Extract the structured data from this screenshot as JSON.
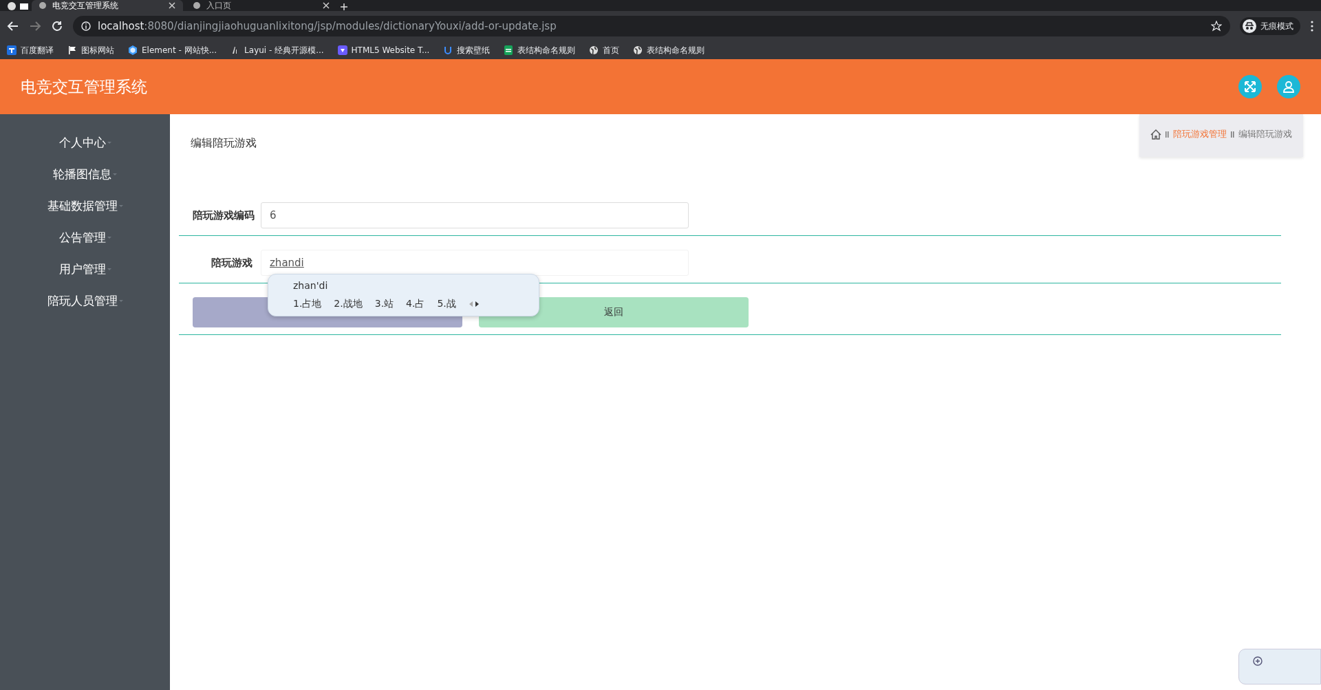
{
  "browser": {
    "tabs": [
      {
        "title": "电竞交互管理系统",
        "selected": true
      },
      {
        "title": "入口页",
        "selected": false
      }
    ],
    "address": {
      "host": "localhost",
      "path": ":8080/dianjingjiaohuguanlixitong/jsp/modules/dictionaryYouxi/add-or-update.jsp"
    },
    "profile": "无痕模式",
    "bookmarks": [
      {
        "label": "百度翻译",
        "kind": "translate"
      },
      {
        "label": "图标网站",
        "kind": "flag"
      },
      {
        "label": "Element - 网站快...",
        "kind": "element"
      },
      {
        "label": "Layui - 经典开源模...",
        "kind": "layui"
      },
      {
        "label": "HTML5 Website T...",
        "kind": "html5"
      },
      {
        "label": "搜索壁纸",
        "kind": "wallpaper"
      },
      {
        "label": "表结构命名规则",
        "kind": "sheet"
      },
      {
        "label": "首页",
        "kind": "globe"
      },
      {
        "label": "表结构命名规则",
        "kind": "globe"
      }
    ]
  },
  "header": {
    "title": "电竞交互管理系统"
  },
  "sidebar": {
    "items": [
      "个人中心",
      "轮播图信息",
      "基础数据管理",
      "公告管理",
      "用户管理",
      "陪玩人员管理"
    ]
  },
  "page": {
    "title": "编辑陪玩游戏",
    "breadcrumb": [
      "陪玩游戏管理",
      "编辑陪玩游戏"
    ]
  },
  "form": {
    "fields": [
      {
        "label": "陪玩游戏编码",
        "value": "6",
        "focused": false
      },
      {
        "label": "陪玩游戏",
        "value": "zhandi",
        "focused": true
      }
    ],
    "buttons": [
      {
        "kind": "submit"
      },
      {
        "kind": "back",
        "label": "返回"
      }
    ]
  },
  "ime": {
    "composition": "zhan'di",
    "candidates": [
      "1.占地",
      "2.战地",
      "3.站",
      "4.占",
      "5.战"
    ]
  }
}
